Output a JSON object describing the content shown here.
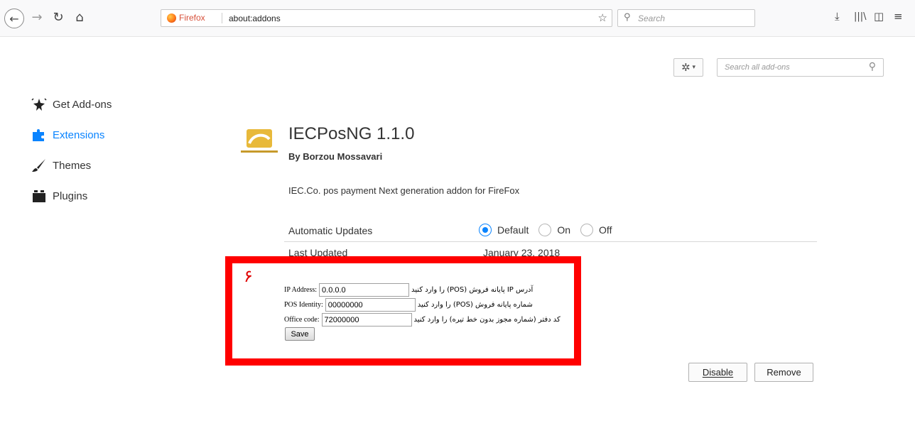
{
  "browser": {
    "identity_label": "Firefox",
    "url": "about:addons",
    "search_placeholder": "Search"
  },
  "addons_manager": {
    "search_placeholder": "Search all add-ons",
    "categories": [
      {
        "label": "Get Add-ons",
        "icon": "get-addons-icon"
      },
      {
        "label": "Extensions",
        "icon": "extensions-icon",
        "selected": true
      },
      {
        "label": "Themes",
        "icon": "themes-icon"
      },
      {
        "label": "Plugins",
        "icon": "plugins-icon"
      }
    ]
  },
  "addon": {
    "title": "IECPosNG 1.1.0",
    "author": "By Borzou Mossavari",
    "description": "IEC.Co. pos payment Next generation addon for FireFox",
    "auto_updates_label": "Automatic Updates",
    "auto_updates_options": [
      "Default",
      "On",
      "Off"
    ],
    "auto_updates_selected": "Default",
    "last_updated_label": "Last Updated",
    "last_updated_value": "January 23, 2018"
  },
  "options": {
    "annotation": "۶",
    "ip_label": "IP Address:",
    "ip_value": "0.0.0.0",
    "ip_hint": "آدرس IP پایانه فروش (POS) را وارد کنید",
    "pos_label": "POS Identity:",
    "pos_value": "00000000",
    "pos_hint": "شماره پایانه فروش (POS) را وارد کنید",
    "office_label": "Office code:",
    "office_value": "72000000",
    "office_hint": "کد دفتر (شماره مجوز بدون خط تیره) را وارد کنید",
    "save_label": "Save"
  },
  "actions": {
    "disable_label": "Disable",
    "remove_label": "Remove"
  },
  "colors": {
    "accent": "#0a84ff",
    "annotation_border": "#ff0000"
  }
}
